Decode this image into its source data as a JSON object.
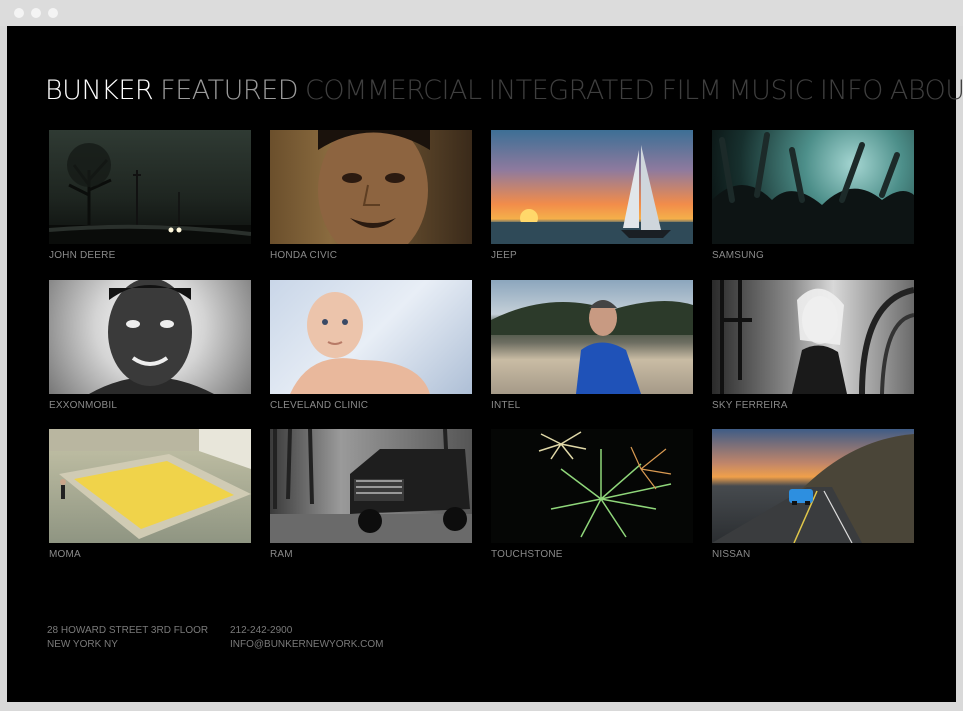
{
  "browser": {
    "dots": 3
  },
  "nav": {
    "brand": "BUNKER",
    "items": [
      "FEATURED",
      "COMMERCIAL",
      "INTEGRATED",
      "FILM",
      "MUSIC",
      "INFO",
      "ABOUT"
    ]
  },
  "tiles": [
    {
      "label": "JOHN DEERE",
      "image": "foggy-road-night-scene"
    },
    {
      "label": "HONDA CIVIC",
      "image": "man-portrait-closeup"
    },
    {
      "label": "JEEP",
      "image": "sailboat-sunset"
    },
    {
      "label": "SAMSUNG",
      "image": "concert-crowd"
    },
    {
      "label": "EXXONMOBIL",
      "image": "smiling-young-man-bw"
    },
    {
      "label": "CLEVELAND CLINIC",
      "image": "baby-portrait"
    },
    {
      "label": "INTEL",
      "image": "man-on-beach"
    },
    {
      "label": "SKY FERREIRA",
      "image": "woman-playground-bw"
    },
    {
      "label": "MOMA",
      "image": "yellow-floor-gallery"
    },
    {
      "label": "RAM",
      "image": "pickup-truck-forest"
    },
    {
      "label": "TOUCHSTONE",
      "image": "fireworks"
    },
    {
      "label": "NISSAN",
      "image": "car-coastal-road"
    }
  ],
  "footer": {
    "address_line1": "28 HOWARD STREET  3RD FLOOR",
    "address_line2": "NEW YORK NY",
    "phone": "212-242-2900",
    "email": "INFO@BUNKERNEWYORK.COM"
  },
  "colors": {
    "background": "#000000",
    "brand": "#ffffff",
    "active_nav": "#9b9b9b",
    "nav": "#3f3f3f",
    "caption": "#8a8a8a"
  }
}
